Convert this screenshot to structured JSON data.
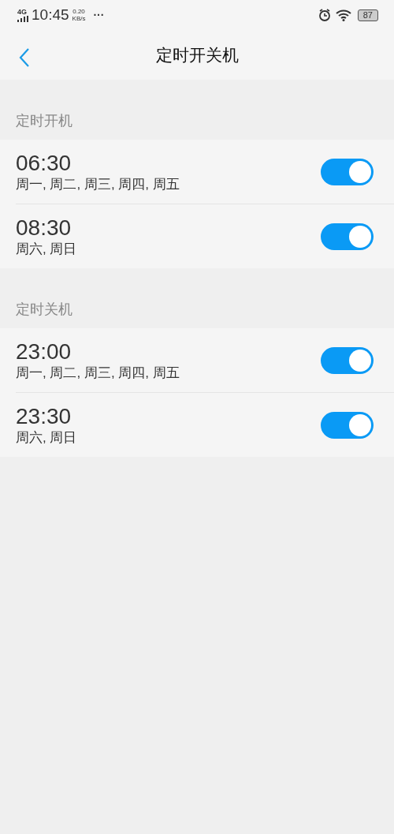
{
  "status_bar": {
    "network": "4G",
    "time": "10:45",
    "speed_value": "0.20",
    "speed_unit": "KB/s",
    "more": "···",
    "battery": "87"
  },
  "header": {
    "title": "定时开关机"
  },
  "sections": [
    {
      "title": "定时开机",
      "items": [
        {
          "time": "06:30",
          "days": "周一, 周二, 周三, 周四, 周五",
          "on": true
        },
        {
          "time": "08:30",
          "days": "周六, 周日",
          "on": true
        }
      ]
    },
    {
      "title": "定时关机",
      "items": [
        {
          "time": "23:00",
          "days": "周一, 周二, 周三, 周四, 周五",
          "on": true
        },
        {
          "time": "23:30",
          "days": "周六, 周日",
          "on": true
        }
      ]
    }
  ]
}
